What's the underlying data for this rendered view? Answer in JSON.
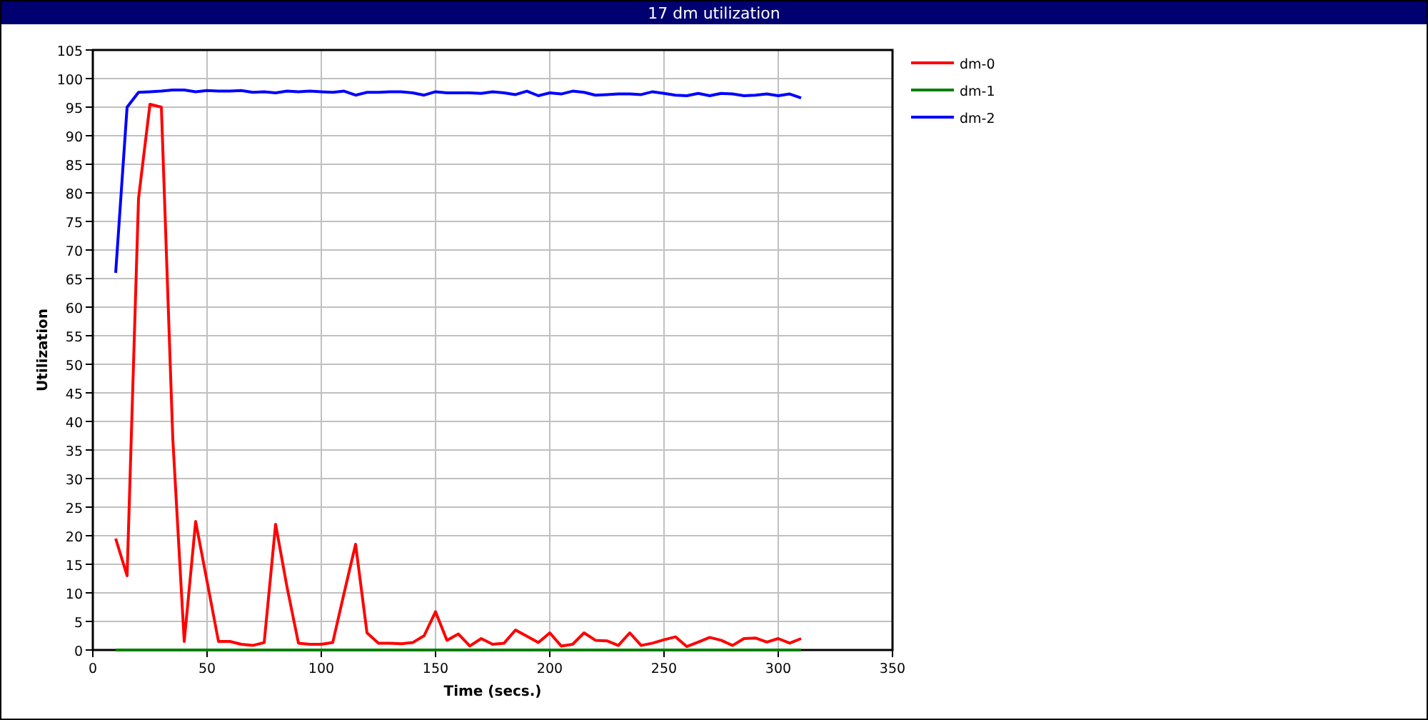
{
  "window": {
    "title": "17 dm utilization"
  },
  "chart": {
    "chart_data": {
      "type": "line",
      "xlabel": "Time (secs.)",
      "ylabel": "Utilization",
      "x": [
        10,
        15,
        20,
        25,
        30,
        35,
        40,
        45,
        50,
        55,
        60,
        65,
        70,
        75,
        80,
        85,
        90,
        95,
        100,
        105,
        110,
        115,
        120,
        125,
        130,
        135,
        140,
        145,
        150,
        155,
        160,
        165,
        170,
        175,
        180,
        185,
        190,
        195,
        200,
        205,
        210,
        215,
        220,
        225,
        230,
        235,
        240,
        245,
        250,
        255,
        260,
        265,
        270,
        275,
        280,
        285,
        290,
        295,
        300,
        305,
        310
      ],
      "series": [
        {
          "name": "dm-0",
          "color": "#ff0000",
          "values": [
            19.5,
            13,
            79,
            95.5,
            95,
            37,
            1.5,
            22.5,
            12,
            1.5,
            1.5,
            1,
            0.8,
            1.3,
            22,
            11,
            1.2,
            1,
            1,
            1.3,
            10,
            18.5,
            3,
            1.2,
            1.2,
            1.1,
            1.3,
            2.5,
            6.7,
            1.7,
            2.8,
            0.7,
            2,
            1,
            1.2,
            3.5,
            2.4,
            1.3,
            3,
            0.7,
            1,
            3,
            1.7,
            1.6,
            0.8,
            3,
            0.8,
            1.2,
            1.8,
            2.3,
            0.6,
            1.4,
            2.2,
            1.7,
            0.8,
            2,
            2.1,
            1.4,
            2,
            1.2,
            2
          ]
        },
        {
          "name": "dm-1",
          "color": "#008000",
          "values": [
            0,
            0,
            0,
            0,
            0,
            0,
            0,
            0,
            0,
            0,
            0,
            0,
            0,
            0,
            0,
            0,
            0,
            0,
            0,
            0,
            0,
            0,
            0,
            0,
            0,
            0,
            0,
            0,
            0,
            0,
            0,
            0,
            0,
            0,
            0,
            0,
            0,
            0,
            0,
            0,
            0,
            0,
            0,
            0,
            0,
            0,
            0,
            0,
            0,
            0,
            0,
            0,
            0,
            0,
            0,
            0,
            0,
            0,
            0,
            0,
            0
          ]
        },
        {
          "name": "dm-2",
          "color": "#0000ff",
          "values": [
            66,
            95,
            97.6,
            97.7,
            97.8,
            98,
            98,
            97.7,
            97.9,
            97.8,
            97.8,
            97.9,
            97.6,
            97.7,
            97.5,
            97.8,
            97.7,
            97.8,
            97.7,
            97.6,
            97.8,
            97.1,
            97.6,
            97.6,
            97.7,
            97.7,
            97.5,
            97.1,
            97.7,
            97.5,
            97.5,
            97.5,
            97.4,
            97.7,
            97.5,
            97.2,
            97.8,
            97,
            97.5,
            97.3,
            97.8,
            97.6,
            97.1,
            97.2,
            97.3,
            97.3,
            97.2,
            97.7,
            97.4,
            97.1,
            97,
            97.4,
            97,
            97.4,
            97.3,
            97,
            97.1,
            97.3,
            97,
            97.3,
            96.6
          ]
        }
      ],
      "xlim": [
        0,
        350
      ],
      "ylim": [
        0,
        105
      ],
      "xticks": [
        0,
        50,
        100,
        150,
        200,
        250,
        300,
        350
      ],
      "yticks": [
        0,
        5,
        10,
        15,
        20,
        25,
        30,
        35,
        40,
        45,
        50,
        55,
        60,
        65,
        70,
        75,
        80,
        85,
        90,
        95,
        100,
        105
      ],
      "grid": true,
      "legend": "right"
    }
  }
}
